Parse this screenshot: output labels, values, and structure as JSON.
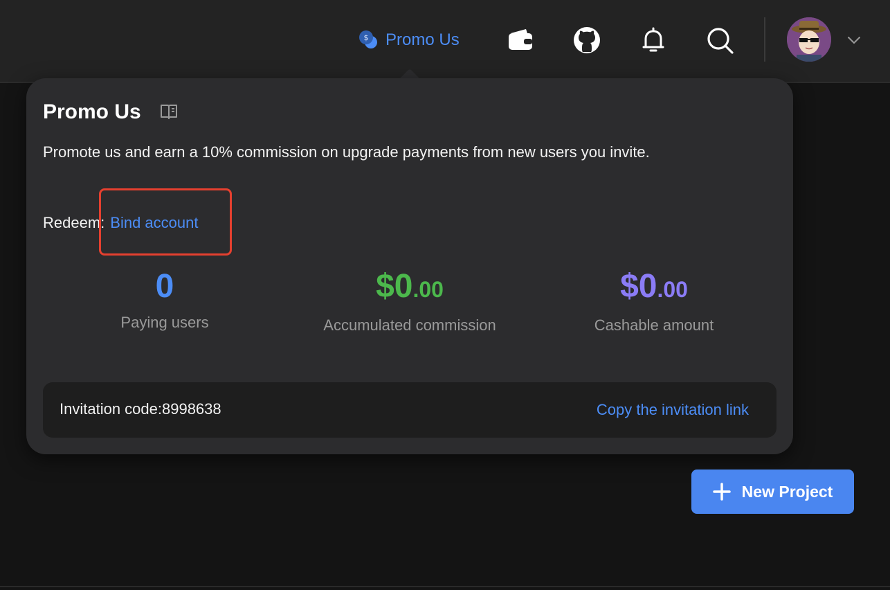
{
  "header": {
    "promo_label": "Promo Us",
    "icons": [
      "wallet-icon",
      "github-icon",
      "bell-icon",
      "search-icon"
    ],
    "user_menu_icon": "chevron-down-icon"
  },
  "popover": {
    "title": "Promo Us",
    "description": "Promote us and earn a 10% commission on upgrade payments from new users you invite.",
    "redeem_label": "Redeem:",
    "bind_link": "Bind account",
    "stats": [
      {
        "value": "0",
        "caption": "Paying users",
        "color": "#4c8df6"
      },
      {
        "value": "$0",
        "cents": ".00",
        "caption": "Accumulated commission",
        "color": "#4cb84c"
      },
      {
        "value": "$0",
        "cents": ".00",
        "caption": "Cashable amount",
        "color": "#8b7cf6"
      }
    ],
    "invitation_code": "Invitation code:8998638",
    "copy_link": "Copy the invitation link"
  },
  "new_project_label": "New Project",
  "colors": {
    "accent": "#4c8df6",
    "highlight": "#e5402f",
    "button": "#4a86f0"
  }
}
